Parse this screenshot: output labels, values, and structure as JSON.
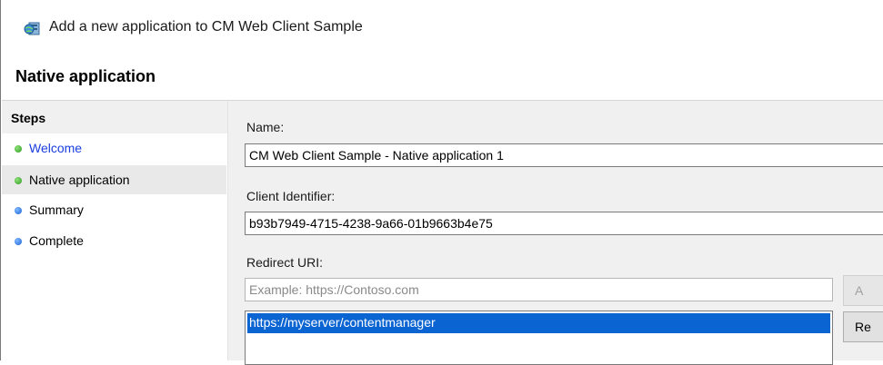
{
  "window": {
    "title": "Add a new application to CM Web Client Sample",
    "icon": "server-globe-icon"
  },
  "page": {
    "title": "Native application"
  },
  "steps": {
    "header": "Steps",
    "items": [
      {
        "label": "Welcome",
        "status": "complete",
        "color": "#2e9a20"
      },
      {
        "label": "Native application",
        "status": "current",
        "color": "#2e9a20"
      },
      {
        "label": "Summary",
        "status": "pending",
        "color": "#1c62d6"
      },
      {
        "label": "Complete",
        "status": "pending",
        "color": "#1c62d6"
      }
    ]
  },
  "form": {
    "name_label": "Name:",
    "name_value": "CM Web Client Sample - Native application 1",
    "client_id_label": "Client Identifier:",
    "client_id_value": "b93b7949-4715-4238-9a66-01b9663b4e75",
    "redirect_label": "Redirect URI:",
    "redirect_placeholder": "Example: https://Contoso.com",
    "redirect_list": [
      "https://myserver/contentmanager"
    ],
    "add_button_label": "A",
    "remove_button_label": "Re"
  },
  "colors": {
    "selection": "#0a64d2",
    "link": "#1a3ee0",
    "pane_bg": "#f0f0f0"
  }
}
